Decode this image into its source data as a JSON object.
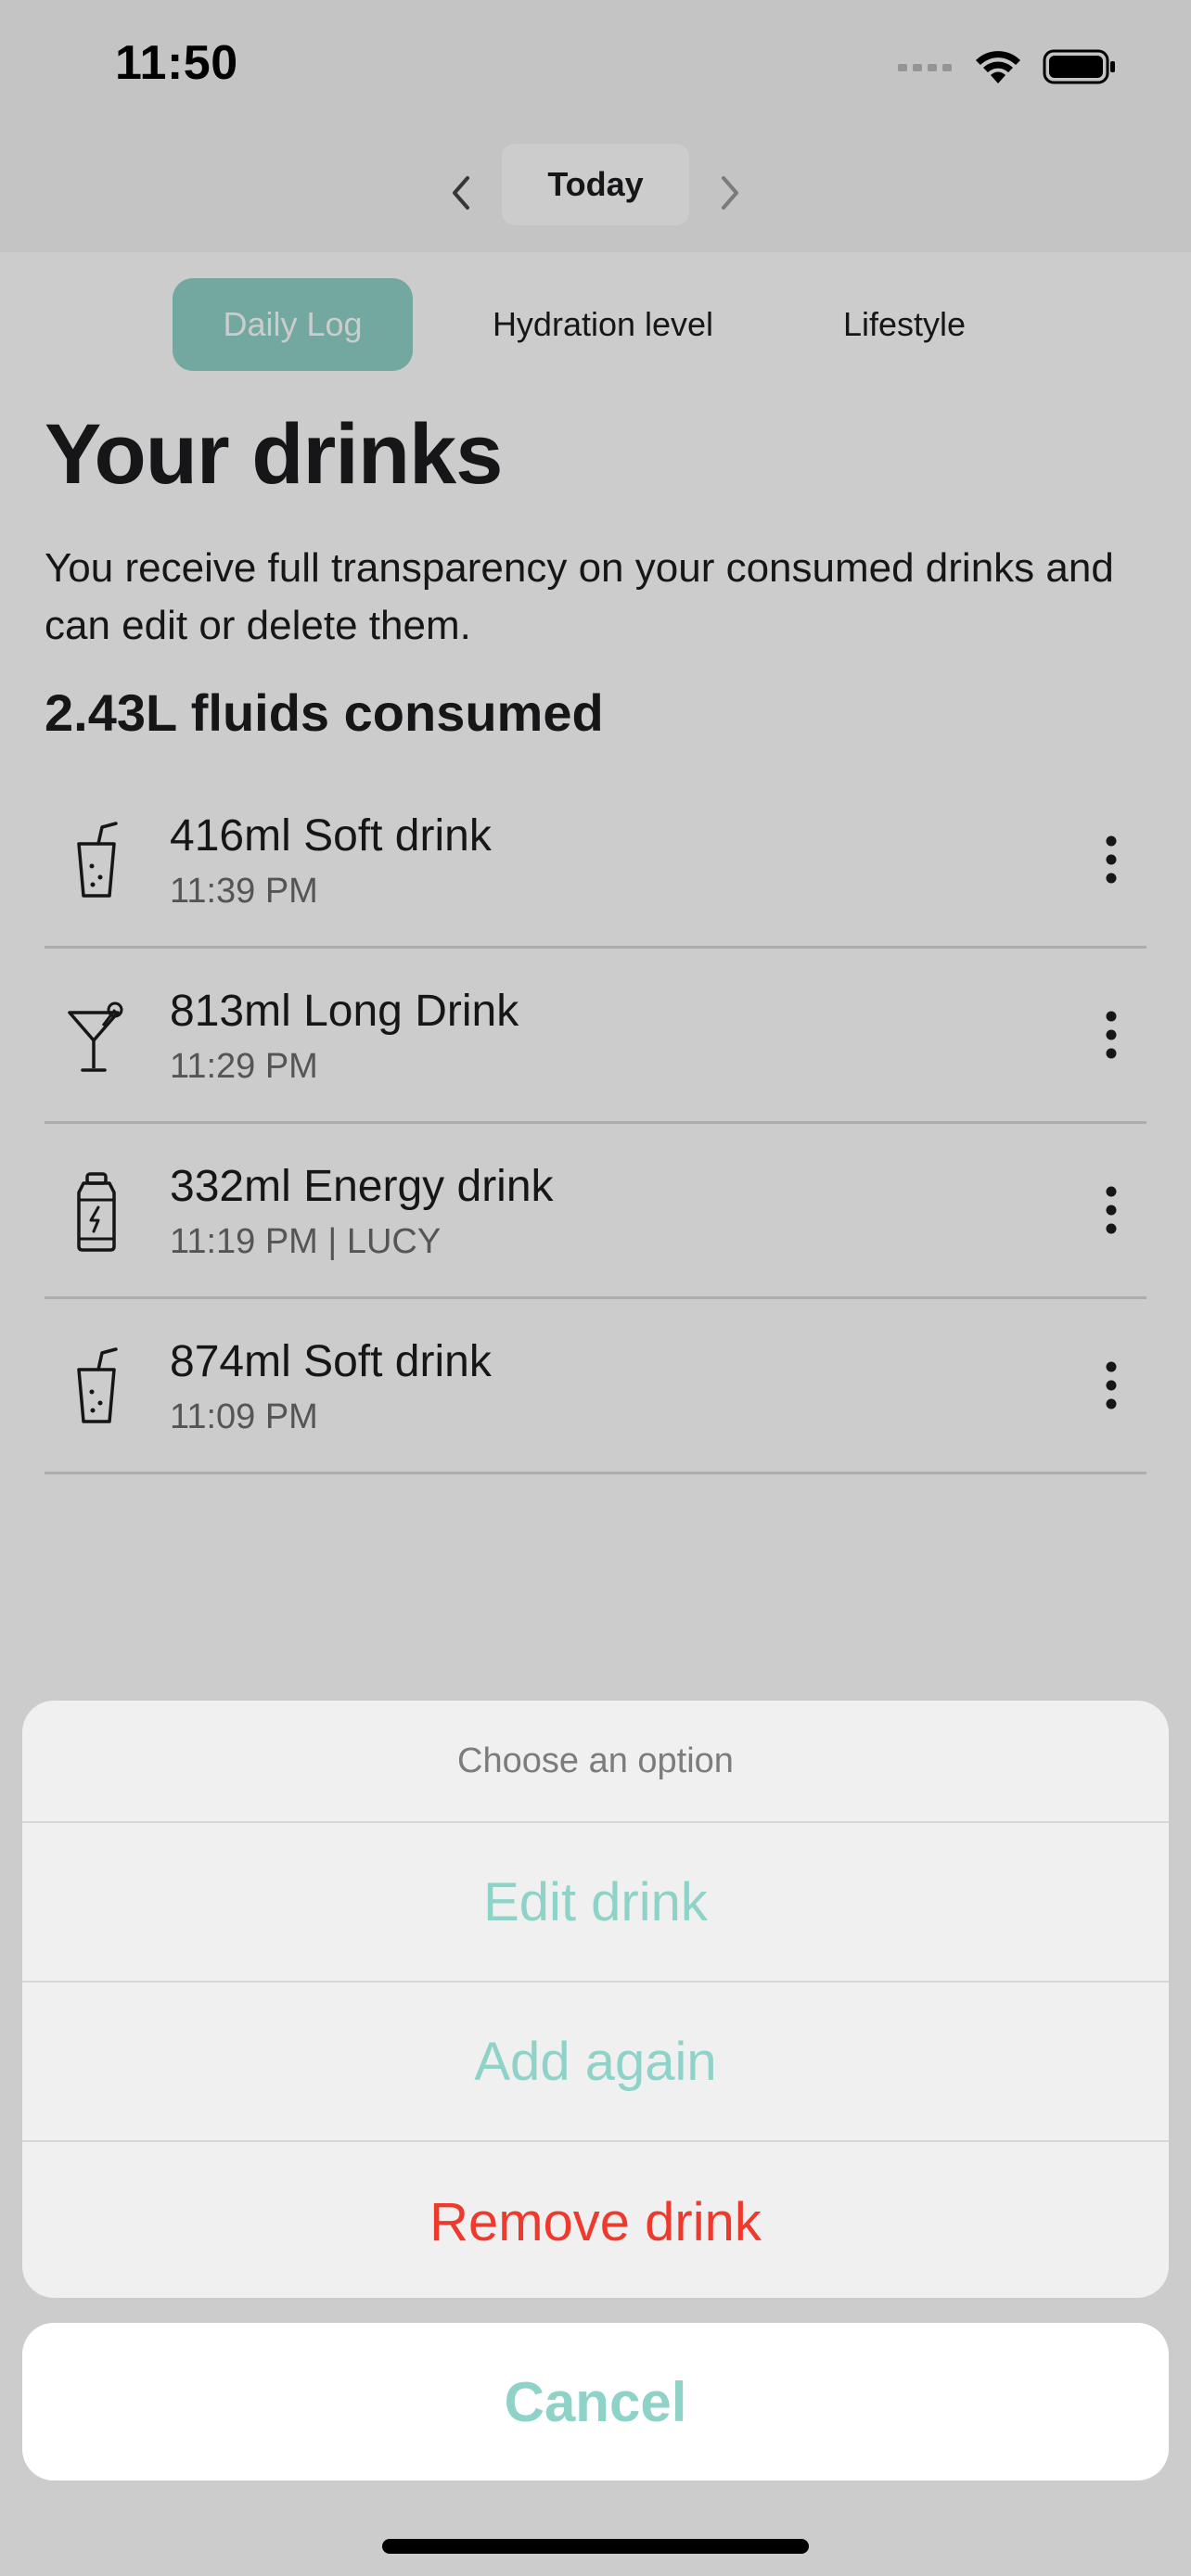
{
  "status_bar": {
    "time": "11:50"
  },
  "date_nav": {
    "label": "Today"
  },
  "tabs": [
    {
      "label": "Daily Log",
      "active": true
    },
    {
      "label": "Hydration level",
      "active": false
    },
    {
      "label": "Lifestyle",
      "active": false
    }
  ],
  "main": {
    "title": "Your drinks",
    "description": "You receive full transparency on your consumed drinks and can edit or delete them.",
    "summary": "2.43L fluids consumed"
  },
  "drinks": [
    {
      "name": "416ml Soft drink",
      "meta": "11:39 PM",
      "icon": "soft-drink-icon"
    },
    {
      "name": "813ml Long Drink",
      "meta": "11:29 PM",
      "icon": "cocktail-icon"
    },
    {
      "name": "332ml Energy drink",
      "meta": "11:19 PM | LUCY",
      "icon": "energy-drink-icon"
    },
    {
      "name": "874ml Soft drink",
      "meta": "11:09 PM",
      "icon": "soft-drink-icon"
    }
  ],
  "action_sheet": {
    "title": "Choose an option",
    "edit_label": "Edit drink",
    "add_again_label": "Add again",
    "remove_label": "Remove drink",
    "cancel_label": "Cancel"
  },
  "colors": {
    "accent": "#8fd2c8",
    "destructive": "#ee3a2d",
    "text": "#1c1c1e",
    "secondary_text": "#6b6b6b"
  }
}
